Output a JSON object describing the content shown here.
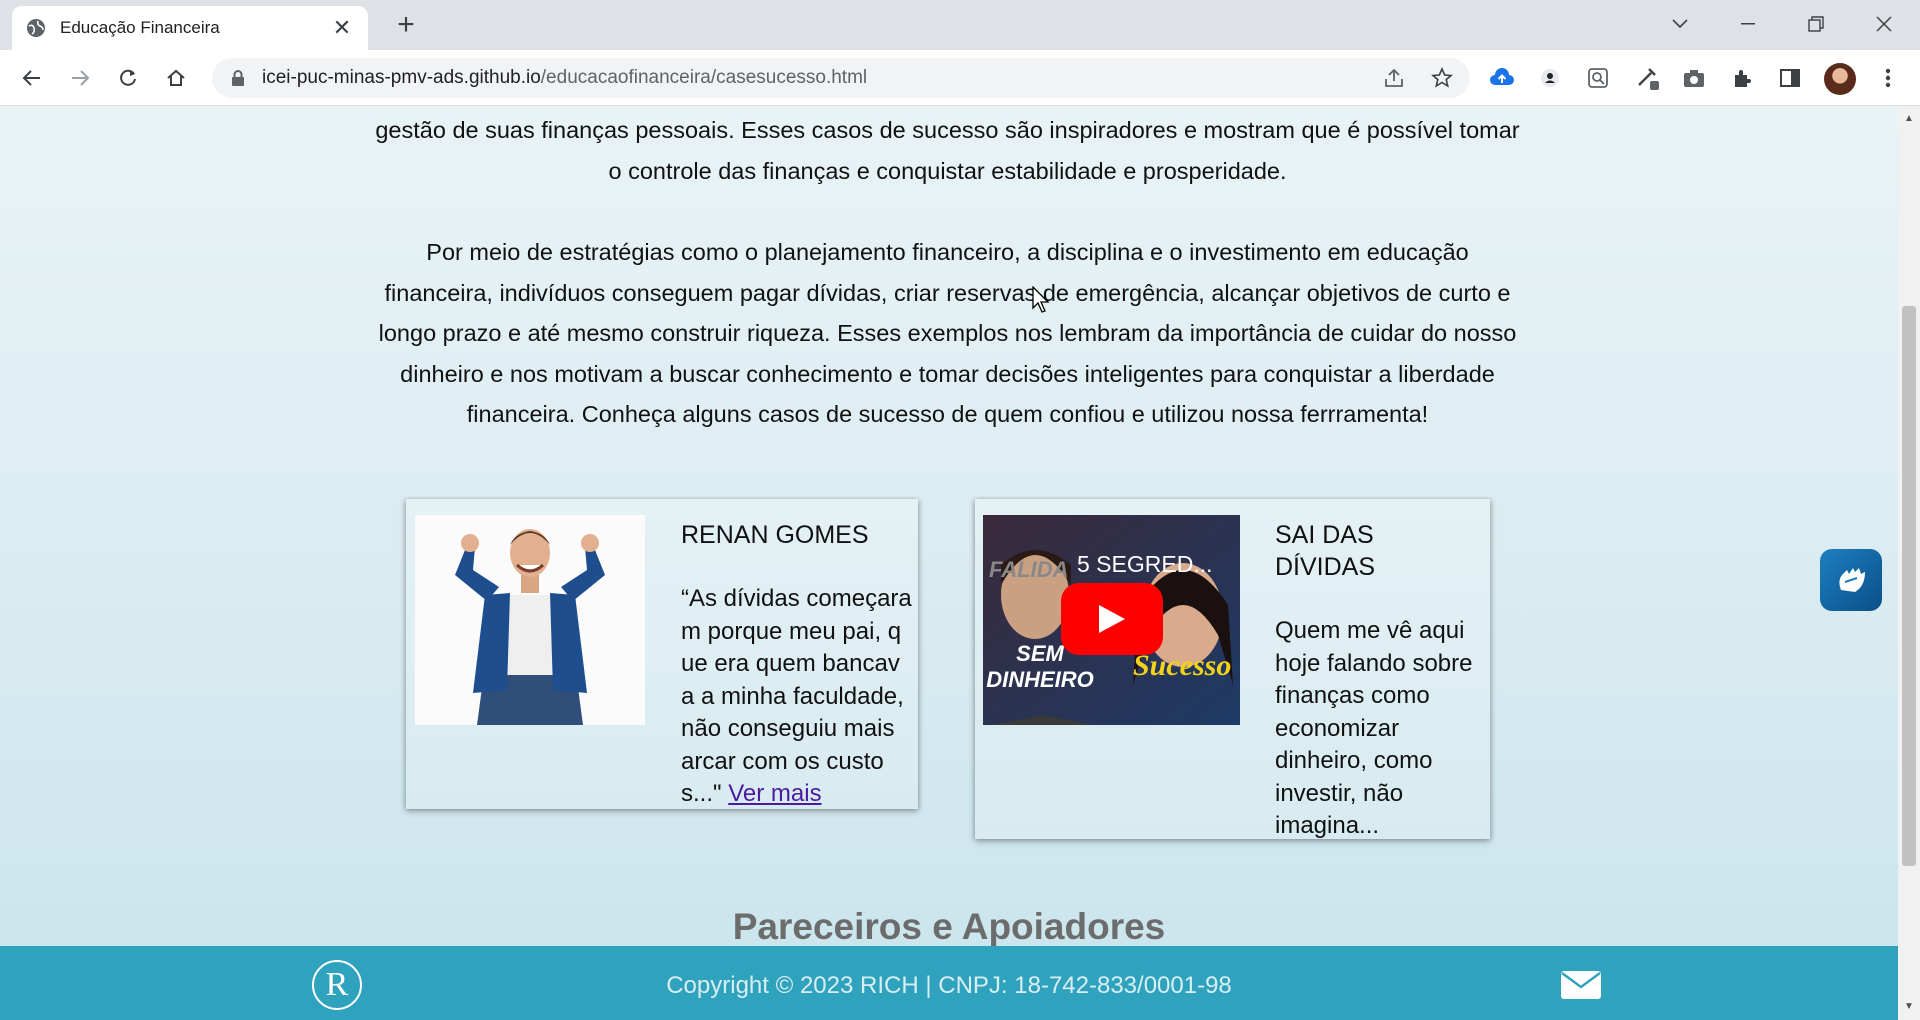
{
  "browser": {
    "tab_title": "Educação Financeira",
    "url_domain": "icei-puc-minas-pmv-ads.github.io",
    "url_path": "/educacaofinanceira/casesucesso.html"
  },
  "intro": {
    "paragraph1": "gestão de suas finanças pessoais. Esses casos de sucesso são inspiradores e mostram que é possível tomar o controle das finanças e conquistar estabilidade e prosperidade.",
    "paragraph2": "Por meio de estratégias como o planejamento financeiro, a disciplina e o investimento em educação financeira, indivíduos conseguem pagar dívidas, criar reservas de emergência, alcançar objetivos de curto e longo prazo e até mesmo construir riqueza. Esses exemplos nos lembram da importância de cuidar do nosso dinheiro e nos motivam a buscar conhecimento e tomar decisões inteligentes para conquistar a liberdade financeira. Conheça alguns casos de sucesso de quem confiou e utilizou nossa ferrramenta!"
  },
  "cards": [
    {
      "name": "RENAN GOMES",
      "quote": "“As dívidas começaram porque meu pai, que era quem bancava a minha faculdade, não conseguiu mais arcar com os custos...\" ",
      "link": "Ver mais"
    },
    {
      "name": "SAI DAS DÍVIDAS",
      "text": "Quem me vê aqui hoje falando sobre finanças como economizar dinheiro, como investir, não imagina...",
      "video": {
        "title": "5 SEGRED...",
        "caption_left_top": "FALIDA",
        "caption_left": "SEM DINHEIRO",
        "caption_right": "Sucesso"
      }
    }
  ],
  "partners_title": "Pareceiros e Apoiadores",
  "footer": {
    "logo_letter": "R",
    "copyright": "Copyright © 2023 RICH | CNPJ: 18-742-833/0001-98"
  },
  "icons": [
    "globe-icon",
    "close-icon",
    "plus-icon",
    "chevron-down-icon",
    "minimize-icon",
    "restore-icon",
    "window-close-icon",
    "back-icon",
    "forward-icon",
    "reload-icon",
    "home-icon",
    "lock-icon",
    "share-icon",
    "star-icon",
    "extensions-icon",
    "side-panel-icon",
    "menu-icon",
    "mail-icon",
    "sign-language-icon",
    "play-icon"
  ]
}
